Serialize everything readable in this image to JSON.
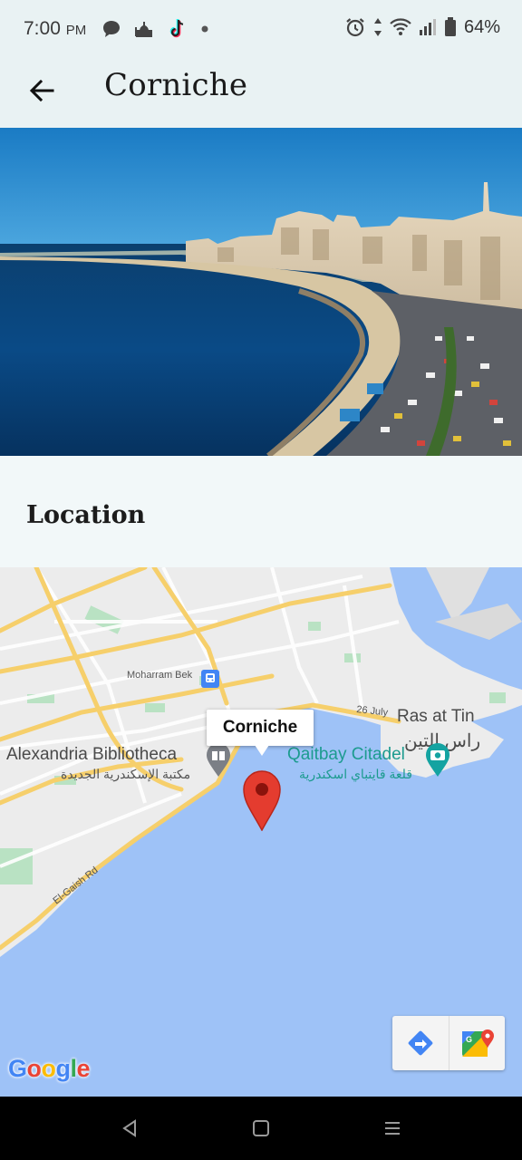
{
  "status_bar": {
    "time": "7:00",
    "ampm": "PM",
    "battery_percent": "64%",
    "left_icons": [
      "chat-bubble-icon",
      "mosque-icon",
      "tiktok-icon",
      "dot-icon"
    ],
    "right_icons": [
      "alarm-icon",
      "data-arrows-icon",
      "wifi-icon",
      "signal-icon",
      "battery-icon"
    ]
  },
  "app_bar": {
    "title": "Corniche",
    "back_icon": "arrow-back-icon"
  },
  "section": {
    "title": "Location"
  },
  "map": {
    "marker_title": "Corniche",
    "labels": {
      "moharram_bek": "Moharram Bek",
      "july_26": "26 July",
      "ras_at_tin": "Ras at Tin",
      "ras_at_tin_ar": "راس التين",
      "alex_bib": "Alexandria Bibliotheca",
      "alex_bib_ar": "مكتبة الإسكندرية الجديدة",
      "qaitbay": "Qaitbay Citadel",
      "qaitbay_ar": "قلعة قايتباي اسكندرية",
      "el_gaish": "El-Gaish Rd"
    },
    "logo": {
      "letters": [
        "G",
        "o",
        "o",
        "g",
        "l",
        "e"
      ],
      "colors": [
        "#4285F4",
        "#EA4335",
        "#FBBC05",
        "#4285F4",
        "#34A853",
        "#EA4335"
      ]
    },
    "colors": {
      "water": "#9ec2f7",
      "land": "#ececec",
      "park": "#b9e2c3",
      "road_major": "#f6cf6b",
      "marker": "#e43c2f"
    }
  },
  "nav_bar": {
    "icons": [
      "nav-back-icon",
      "nav-home-icon",
      "nav-recents-icon"
    ]
  }
}
